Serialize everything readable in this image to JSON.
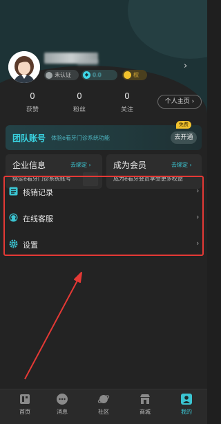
{
  "profile": {
    "name_blurred": "",
    "auth_badge": "未认证",
    "coin_badge": "0.0",
    "vip_badge": "权",
    "stats": [
      {
        "value": "0",
        "label": "获赞"
      },
      {
        "value": "0",
        "label": "粉丝"
      },
      {
        "value": "0",
        "label": "关注"
      }
    ],
    "home_button": "个人主页 ›"
  },
  "team": {
    "title": "团队账号",
    "subtitle": "体验e看牙门诊系统功能",
    "tag": "免费",
    "button": "去开通"
  },
  "cards": [
    {
      "title": "企业信息",
      "link": "去绑定 ›",
      "desc": "绑定e看牙门诊系统账号"
    },
    {
      "title": "成为会员",
      "link": "去绑定 ›",
      "desc": "成为e看牙会员享受更多权益"
    }
  ],
  "menu": [
    {
      "label": "核销记录",
      "icon": "list-icon"
    },
    {
      "label": "在线客服",
      "icon": "headset-icon"
    },
    {
      "label": "设置",
      "icon": "gear-icon"
    }
  ],
  "nav": [
    {
      "label": "首页",
      "icon": "home-icon",
      "active": false
    },
    {
      "label": "消息",
      "icon": "chat-icon",
      "active": false
    },
    {
      "label": "社区",
      "icon": "planet-icon",
      "active": false
    },
    {
      "label": "商城",
      "icon": "store-icon",
      "active": false
    },
    {
      "label": "我的",
      "icon": "profile-icon",
      "active": true
    }
  ],
  "colors": {
    "accent": "#3bc4d1",
    "highlight_border": "#e53935",
    "background": "#232323"
  }
}
